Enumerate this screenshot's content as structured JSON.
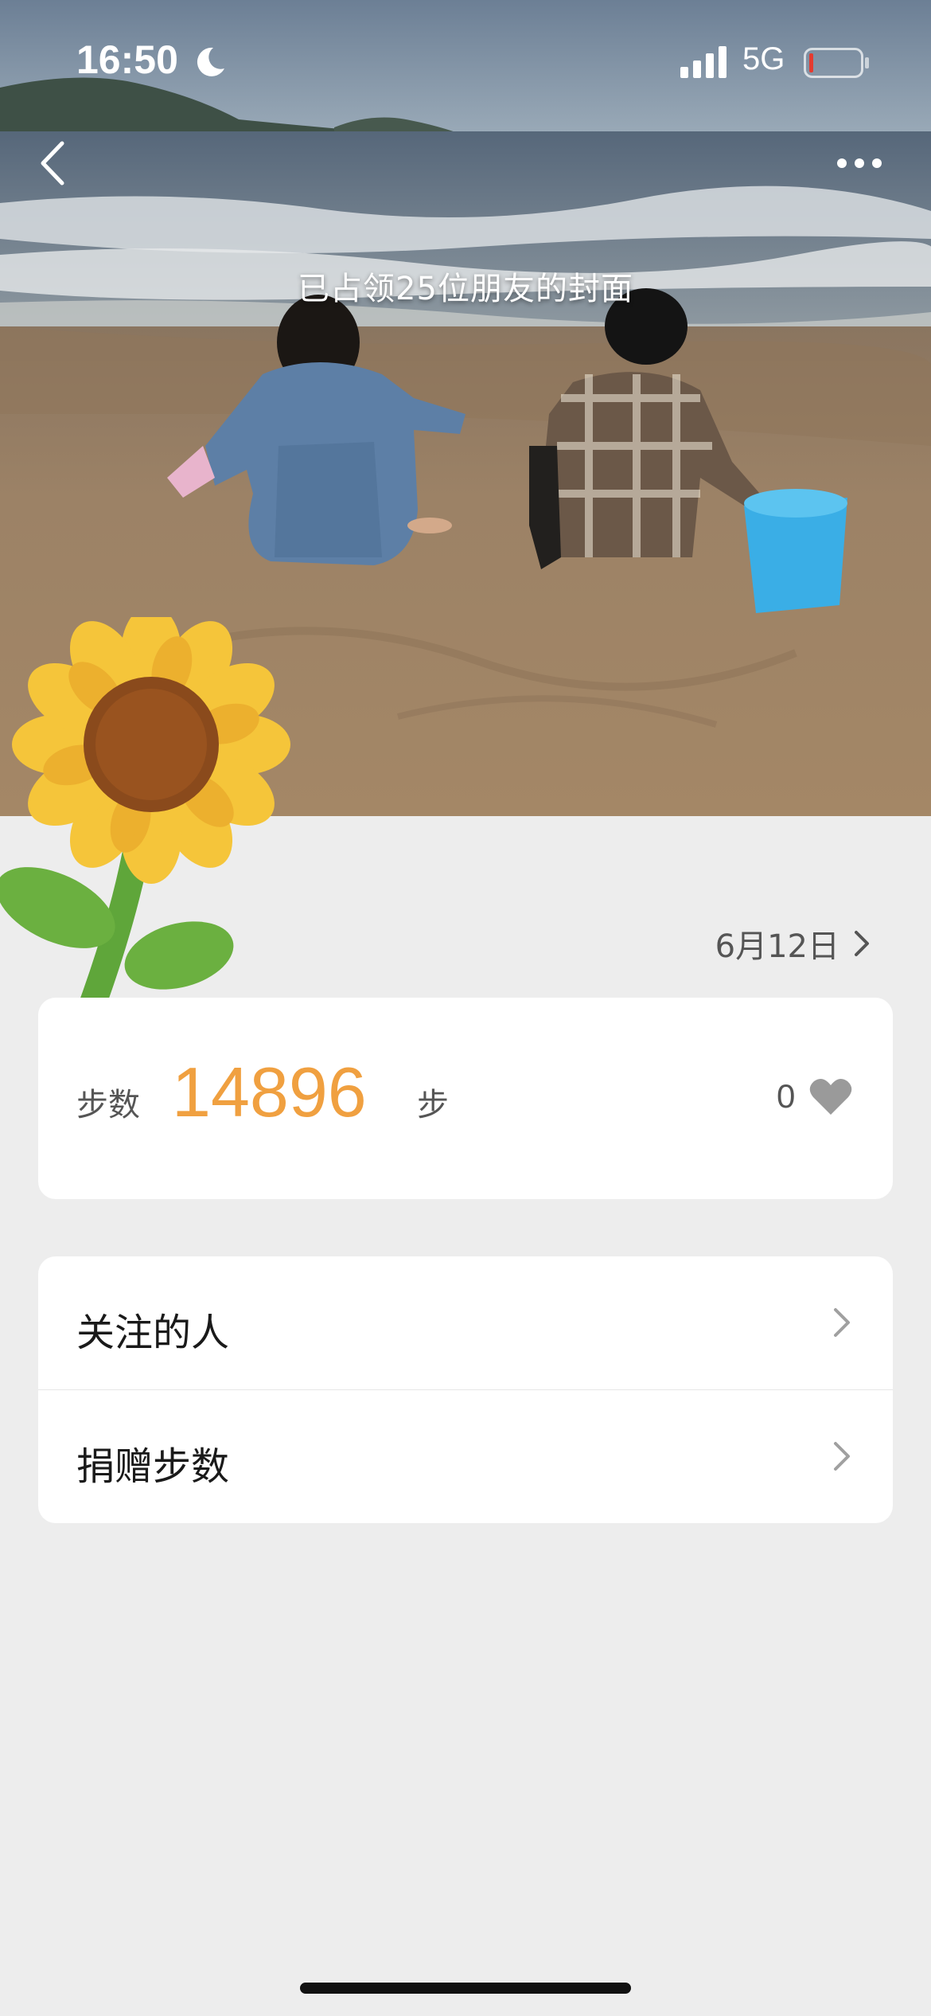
{
  "status_bar": {
    "time": "16:50",
    "network": "5G",
    "icons": [
      "moon-icon",
      "signal-icon",
      "battery-icon"
    ]
  },
  "cover": {
    "caption": "已占领25位朋友的封面"
  },
  "header": {
    "date": "6月12日"
  },
  "steps_card": {
    "label": "步数",
    "value": "14896",
    "unit": "步",
    "likes": "0",
    "value_color": "#f0a040"
  },
  "menu": {
    "items": [
      {
        "label": "关注的人"
      },
      {
        "label": "捐赠步数"
      }
    ]
  },
  "colors": {
    "background": "#ededed",
    "card": "#ffffff",
    "accent": "#f0a040"
  }
}
